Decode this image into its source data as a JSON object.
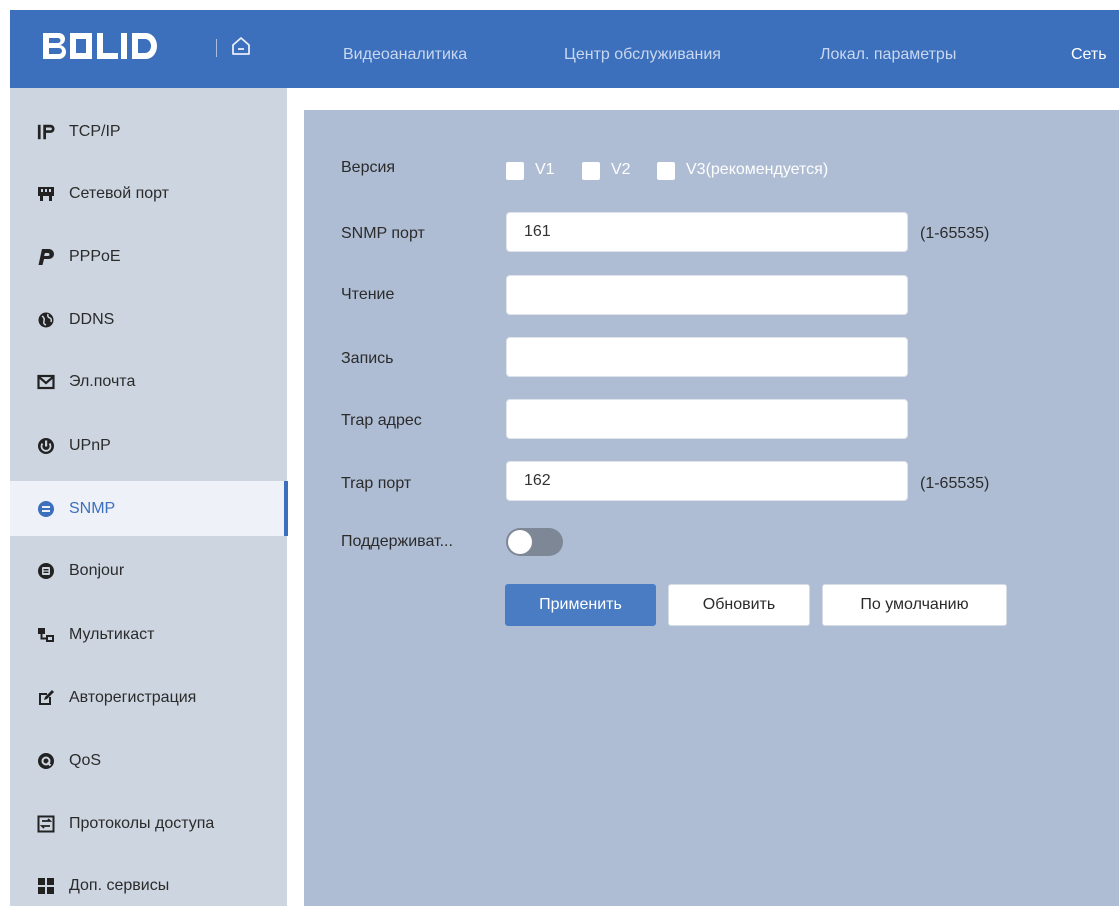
{
  "header": {
    "logo_text": "BOLID",
    "nav": [
      "Видеоаналитика",
      "Центр обслуживания",
      "Локал. параметры",
      "Сеть"
    ],
    "accent_color": "#3c6fbc"
  },
  "sidebar": {
    "items": [
      {
        "label": "TCP/IP",
        "icon": "ip-icon"
      },
      {
        "label": "Сетевой порт",
        "icon": "network-port-icon"
      },
      {
        "label": "PPPoE",
        "icon": "pppoe-icon"
      },
      {
        "label": "DDNS",
        "icon": "globe-icon"
      },
      {
        "label": "Эл.почта",
        "icon": "mail-icon"
      },
      {
        "label": "UPnP",
        "icon": "power-icon"
      },
      {
        "label": "SNMP",
        "icon": "snmp-icon"
      },
      {
        "label": "Bonjour",
        "icon": "bonjour-icon"
      },
      {
        "label": "Мультикаст",
        "icon": "multicast-icon"
      },
      {
        "label": "Авторегистрация",
        "icon": "edit-icon"
      },
      {
        "label": "QoS",
        "icon": "qos-icon"
      },
      {
        "label": "Протоколы доступа",
        "icon": "access-protocols-icon"
      },
      {
        "label": "Доп. сервисы",
        "icon": "grid-icon"
      }
    ],
    "active": "SNMP"
  },
  "form": {
    "version_label": "Версия",
    "versions": [
      {
        "label": "V1",
        "checked": false
      },
      {
        "label": "V2",
        "checked": false
      },
      {
        "label": "V3(рекомендуется)",
        "checked": false
      }
    ],
    "snmp_port_label": "SNMP порт",
    "snmp_port_value": "161",
    "snmp_port_range": "(1-65535)",
    "read_label": "Чтение",
    "read_value": "",
    "write_label": "Запись",
    "write_value": "",
    "trap_address_label": "Trap адрес",
    "trap_address_value": "",
    "trap_port_label": "Trap порт",
    "trap_port_value": "162",
    "trap_port_range": "(1-65535)",
    "support_label": "Поддерживат...",
    "support_enabled": false
  },
  "buttons": {
    "apply": "Применить",
    "refresh": "Обновить",
    "default": "По умолчанию"
  }
}
